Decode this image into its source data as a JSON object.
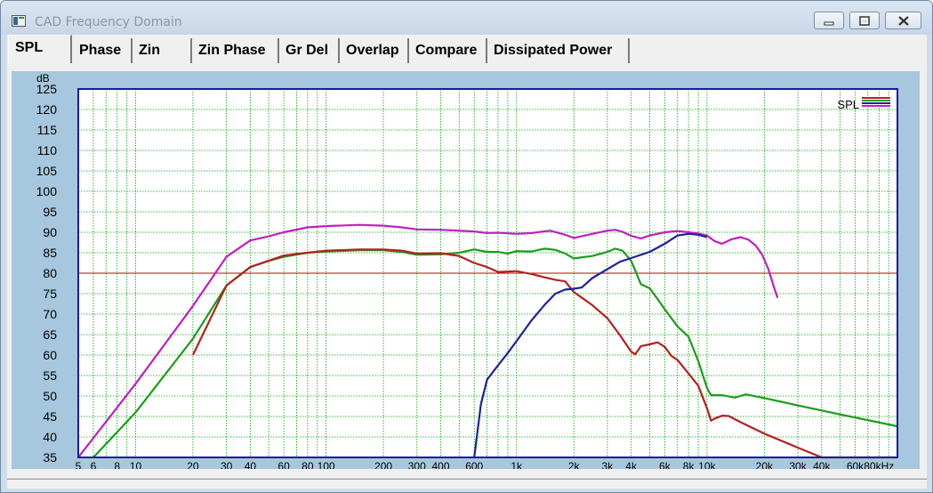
{
  "window": {
    "title": "CAD Frequency Domain",
    "controls": [
      "minimize",
      "maximize",
      "close"
    ],
    "icon": "app-window-icon"
  },
  "tabs": [
    {
      "label": "SPL",
      "active": true
    },
    {
      "label": "Phase",
      "active": false
    },
    {
      "label": "Zin",
      "active": false
    },
    {
      "label": "Zin Phase",
      "active": false
    },
    {
      "label": "Gr Del",
      "active": false
    },
    {
      "label": "Overlap",
      "active": false
    },
    {
      "label": "Compare",
      "active": false
    },
    {
      "label": "Dissipated Power",
      "active": false
    }
  ],
  "chart_data": {
    "type": "line",
    "title": "",
    "xlabel": "",
    "ylabel": "dB",
    "x_unit": "Hz",
    "x_scale": "log",
    "xlim": [
      5,
      100000
    ],
    "ylim": [
      35,
      125
    ],
    "y_ticks": [
      35,
      40,
      45,
      50,
      55,
      60,
      65,
      70,
      75,
      80,
      85,
      90,
      95,
      100,
      105,
      110,
      115,
      120,
      125
    ],
    "x_tick_labels": [
      {
        "v": 5,
        "t": "5"
      },
      {
        "v": 6,
        "t": "6"
      },
      {
        "v": 8,
        "t": "8"
      },
      {
        "v": 10,
        "t": "10"
      },
      {
        "v": 20,
        "t": "20"
      },
      {
        "v": 30,
        "t": "30"
      },
      {
        "v": 40,
        "t": "40"
      },
      {
        "v": 60,
        "t": "60"
      },
      {
        "v": 80,
        "t": "80"
      },
      {
        "v": 100,
        "t": "100"
      },
      {
        "v": 200,
        "t": "200"
      },
      {
        "v": 300,
        "t": "300"
      },
      {
        "v": 400,
        "t": "400"
      },
      {
        "v": 600,
        "t": "600"
      },
      {
        "v": 1000,
        "t": "1k"
      },
      {
        "v": 2000,
        "t": "2k"
      },
      {
        "v": 3000,
        "t": "3k"
      },
      {
        "v": 4000,
        "t": "4k"
      },
      {
        "v": 6000,
        "t": "6k"
      },
      {
        "v": 8000,
        "t": "8k"
      },
      {
        "v": 10000,
        "t": "10k"
      },
      {
        "v": 20000,
        "t": "20k"
      },
      {
        "v": 30000,
        "t": "30k"
      },
      {
        "v": 40000,
        "t": "40k"
      },
      {
        "v": 60000,
        "t": "60k"
      },
      {
        "v": 80000,
        "t": "80kHz"
      }
    ],
    "grid": true,
    "grid_color": "#00a000",
    "plot_background": "#ffffff",
    "panel_background": "#a6c7dd",
    "frame_color": "#1a1aa8",
    "legend": {
      "label": "SPL",
      "placement": "top-right",
      "colors": [
        "#b52020",
        "#1a9e1a",
        "#2020a0",
        "#c020c0"
      ]
    },
    "reference_line": {
      "y": 80,
      "color": "#c00000"
    },
    "series": [
      {
        "color": "#c020c0",
        "points": [
          [
            5,
            35
          ],
          [
            10,
            53
          ],
          [
            20,
            72
          ],
          [
            30,
            84
          ],
          [
            40,
            88
          ],
          [
            50,
            89
          ],
          [
            60,
            90
          ],
          [
            80,
            91.2
          ],
          [
            100,
            91.5
          ],
          [
            150,
            91.8
          ],
          [
            200,
            91.6
          ],
          [
            250,
            91.2
          ],
          [
            300,
            90.7
          ],
          [
            400,
            90.6
          ],
          [
            500,
            90.4
          ],
          [
            600,
            90.2
          ],
          [
            700,
            89.8
          ],
          [
            800,
            89.9
          ],
          [
            1000,
            89.6
          ],
          [
            1200,
            89.8
          ],
          [
            1500,
            90.4
          ],
          [
            1800,
            89.4
          ],
          [
            2000,
            88.6
          ],
          [
            2500,
            89.6
          ],
          [
            3000,
            90.4
          ],
          [
            3300,
            90.6
          ],
          [
            3600,
            90.1
          ],
          [
            4000,
            89.1
          ],
          [
            4500,
            88.5
          ],
          [
            5000,
            89.2
          ],
          [
            6000,
            90
          ],
          [
            7000,
            90.3
          ],
          [
            8000,
            90
          ],
          [
            9000,
            89.7
          ],
          [
            10000,
            89.2
          ],
          [
            11000,
            87.8
          ],
          [
            12000,
            87.2
          ],
          [
            13500,
            88.3
          ],
          [
            15000,
            88.8
          ],
          [
            16500,
            88.2
          ],
          [
            18000,
            86.8
          ],
          [
            19500,
            84.5
          ],
          [
            21000,
            81
          ],
          [
            22500,
            76.5
          ],
          [
            23500,
            74
          ]
        ]
      },
      {
        "color": "#1a9e1a",
        "points": [
          [
            6,
            35
          ],
          [
            10,
            46
          ],
          [
            20,
            64
          ],
          [
            30,
            77
          ],
          [
            40,
            81.5
          ],
          [
            50,
            83
          ],
          [
            60,
            84
          ],
          [
            80,
            85
          ],
          [
            100,
            85.3
          ],
          [
            150,
            85.6
          ],
          [
            200,
            85.6
          ],
          [
            250,
            85.2
          ],
          [
            300,
            84.5
          ],
          [
            400,
            84.6
          ],
          [
            500,
            85
          ],
          [
            600,
            85.8
          ],
          [
            700,
            85.2
          ],
          [
            800,
            85.2
          ],
          [
            900,
            84.8
          ],
          [
            1000,
            85.4
          ],
          [
            1200,
            85.3
          ],
          [
            1400,
            86
          ],
          [
            1600,
            85.7
          ],
          [
            1800,
            84.8
          ],
          [
            2000,
            83.6
          ],
          [
            2500,
            84.2
          ],
          [
            3000,
            85.2
          ],
          [
            3300,
            86
          ],
          [
            3600,
            85.5
          ],
          [
            4000,
            83
          ],
          [
            4500,
            77.3
          ],
          [
            5000,
            76.3
          ],
          [
            5500,
            73.7
          ],
          [
            6000,
            71.2
          ],
          [
            7000,
            67
          ],
          [
            8000,
            64.5
          ],
          [
            9000,
            58.5
          ],
          [
            10000,
            52
          ],
          [
            10500,
            50.2
          ],
          [
            12000,
            50.2
          ],
          [
            14000,
            49.6
          ],
          [
            16000,
            50.4
          ],
          [
            20000,
            49.5
          ],
          [
            30000,
            47.7
          ],
          [
            50000,
            45.5
          ],
          [
            100000,
            42.6
          ]
        ]
      },
      {
        "color": "#b52020",
        "points": [
          [
            20,
            60
          ],
          [
            30,
            77
          ],
          [
            40,
            81.5
          ],
          [
            60,
            84.3
          ],
          [
            80,
            85
          ],
          [
            100,
            85.5
          ],
          [
            150,
            85.8
          ],
          [
            200,
            85.8
          ],
          [
            250,
            85.5
          ],
          [
            300,
            84.8
          ],
          [
            400,
            84.9
          ],
          [
            500,
            84.2
          ],
          [
            600,
            82.5
          ],
          [
            700,
            81.5
          ],
          [
            800,
            80.3
          ],
          [
            1000,
            80.5
          ],
          [
            1200,
            79.8
          ],
          [
            1400,
            79
          ],
          [
            1600,
            78.4
          ],
          [
            1800,
            78
          ],
          [
            2000,
            75.4
          ],
          [
            2500,
            72.2
          ],
          [
            3000,
            69
          ],
          [
            3500,
            64.8
          ],
          [
            4000,
            60.8
          ],
          [
            4200,
            60.2
          ],
          [
            4500,
            62.2
          ],
          [
            5000,
            62.6
          ],
          [
            5500,
            63.1
          ],
          [
            6000,
            62
          ],
          [
            6500,
            59.8
          ],
          [
            7000,
            58.8
          ],
          [
            8000,
            55.5
          ],
          [
            9000,
            52.5
          ],
          [
            10000,
            47
          ],
          [
            10500,
            44
          ],
          [
            11000,
            44.5
          ],
          [
            12000,
            45.2
          ],
          [
            13000,
            45.1
          ],
          [
            15000,
            43.6
          ],
          [
            20000,
            40.8
          ],
          [
            30000,
            37.4
          ],
          [
            40000,
            35
          ],
          [
            100000,
            35
          ]
        ]
      },
      {
        "color": "#2020a0",
        "points": [
          [
            600,
            35
          ],
          [
            650,
            48
          ],
          [
            700,
            54
          ],
          [
            800,
            57.5
          ],
          [
            900,
            60.5
          ],
          [
            1000,
            63.4
          ],
          [
            1200,
            68.5
          ],
          [
            1400,
            72.2
          ],
          [
            1600,
            75
          ],
          [
            1800,
            76
          ],
          [
            2000,
            76.2
          ],
          [
            2200,
            76.5
          ],
          [
            2500,
            78.8
          ],
          [
            3000,
            81
          ],
          [
            3500,
            82.8
          ],
          [
            4000,
            83.7
          ],
          [
            5000,
            85.2
          ],
          [
            6000,
            87.2
          ],
          [
            7000,
            89.2
          ],
          [
            8000,
            89.6
          ],
          [
            9000,
            89.4
          ],
          [
            10000,
            88.8
          ]
        ]
      }
    ]
  }
}
